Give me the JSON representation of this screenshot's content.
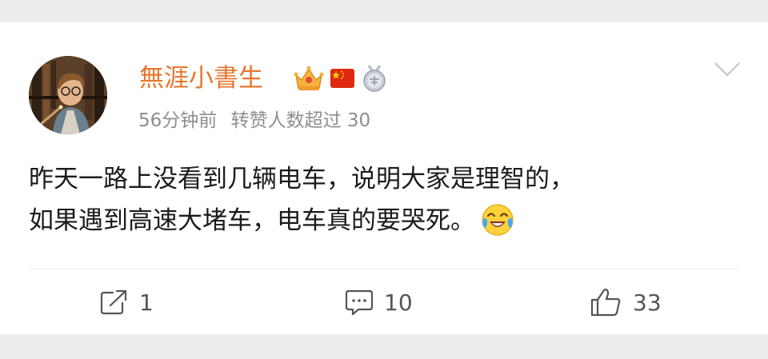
{
  "post": {
    "author": {
      "name": "無涯小書生",
      "badges": [
        "crown-badge-icon",
        "china-flag-icon",
        "medal-badge-icon"
      ]
    },
    "meta": {
      "time": "56分钟前",
      "stats": "转赞人数超过 30"
    },
    "content": {
      "line1": "昨天一路上没看到几辆电车，说明大家是理智的，",
      "line2": "如果遇到高速大堵车，电车真的要哭死。",
      "emoji": "laughing-crying-emoji"
    },
    "actions": {
      "repost_count": "1",
      "comment_count": "10",
      "like_count": "33"
    }
  },
  "colors": {
    "username": "#e8762d",
    "meta_text": "#8e8e8e",
    "body_text": "#1b1b1b",
    "action_text": "#555555",
    "background": "#ebebeb",
    "card": "#ffffff"
  }
}
